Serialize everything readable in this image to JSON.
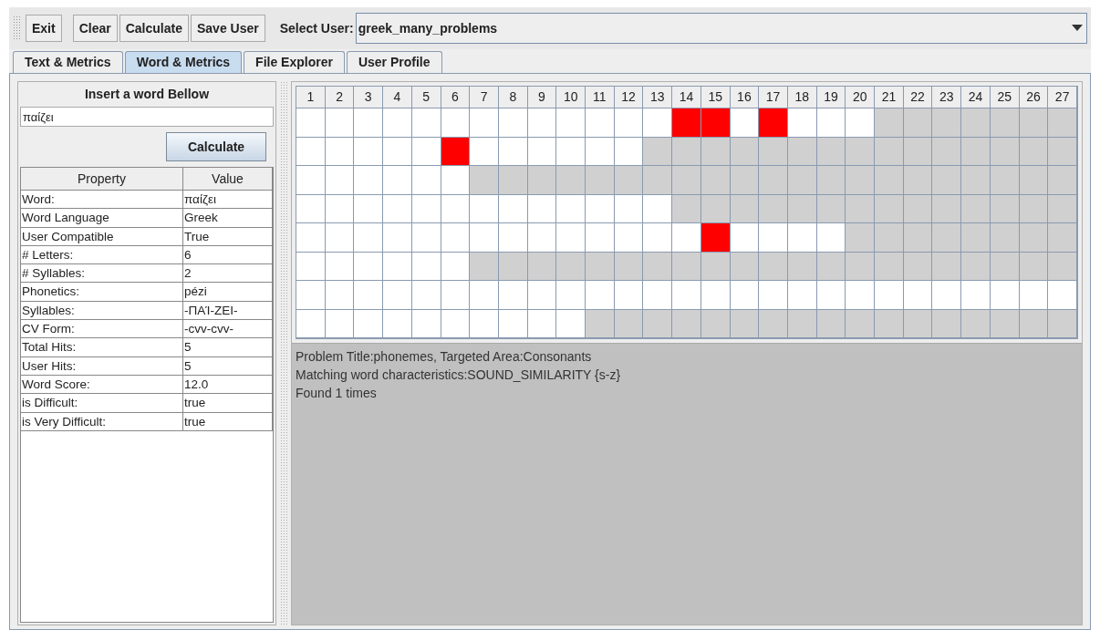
{
  "toolbar": {
    "buttons": [
      "Exit",
      "Clear",
      "Calculate",
      "Save User"
    ],
    "select_label": "Select User:",
    "select_value": "greek_many_problems"
  },
  "tabs": [
    {
      "label": "Text & Metrics",
      "selected": false
    },
    {
      "label": "Word & Metrics",
      "selected": true
    },
    {
      "label": "File Explorer",
      "selected": false
    },
    {
      "label": "User Profile",
      "selected": false
    }
  ],
  "word_panel": {
    "title": "Insert a word Bellow",
    "word": "παίζει",
    "button": "Calculate"
  },
  "properties": {
    "columns": [
      "Property",
      "Value"
    ],
    "rows": [
      [
        "Word:",
        "παίζει"
      ],
      [
        "Word Language",
        "Greek"
      ],
      [
        "User Compatible",
        "True"
      ],
      [
        "# Letters:",
        "6"
      ],
      [
        "# Syllables:",
        "2"
      ],
      [
        "Phonetics:",
        "pézi"
      ],
      [
        "Syllables:",
        "-ΠΑΊ-ΖΕΙ-"
      ],
      [
        "CV Form:",
        "-cvv-cvv-"
      ],
      [
        "Total Hits:",
        "5"
      ],
      [
        "User Hits:",
        "5"
      ],
      [
        "Word Score:",
        "12.0"
      ],
      [
        "is Difficult:",
        "true"
      ],
      [
        "is Very Difficult:",
        "true"
      ]
    ]
  },
  "grid": {
    "columns": [
      "1",
      "2",
      "3",
      "4",
      "5",
      "6",
      "7",
      "8",
      "9",
      "10",
      "11",
      "12",
      "13",
      "14",
      "15",
      "16",
      "17",
      "18",
      "19",
      "20",
      "21",
      "22",
      "23",
      "24",
      "25",
      "26",
      "27"
    ],
    "rows": [
      [
        {
          "kind": "open"
        },
        {
          "kind": "open"
        },
        {
          "kind": "open"
        },
        {
          "kind": "open"
        },
        {
          "kind": "open"
        },
        {
          "kind": "open"
        },
        {
          "kind": "open"
        },
        {
          "kind": "open"
        },
        {
          "kind": "open"
        },
        {
          "kind": "open"
        },
        {
          "kind": "open"
        },
        {
          "kind": "open"
        },
        {
          "kind": "open"
        },
        {
          "kind": "hit"
        },
        {
          "kind": "hit"
        },
        {
          "kind": "open"
        },
        {
          "kind": "hit"
        },
        {
          "kind": "open"
        },
        {
          "kind": "open"
        },
        {
          "kind": "open"
        },
        {
          "kind": "blocked"
        },
        {
          "kind": "blocked"
        },
        {
          "kind": "blocked"
        },
        {
          "kind": "blocked"
        },
        {
          "kind": "blocked"
        },
        {
          "kind": "blocked"
        },
        {
          "kind": "blocked"
        }
      ],
      [
        {
          "kind": "open"
        },
        {
          "kind": "open"
        },
        {
          "kind": "open"
        },
        {
          "kind": "open"
        },
        {
          "kind": "open"
        },
        {
          "kind": "hit"
        },
        {
          "kind": "open"
        },
        {
          "kind": "open"
        },
        {
          "kind": "open"
        },
        {
          "kind": "open"
        },
        {
          "kind": "open"
        },
        {
          "kind": "open"
        },
        {
          "kind": "blocked"
        },
        {
          "kind": "blocked"
        },
        {
          "kind": "blocked"
        },
        {
          "kind": "blocked"
        },
        {
          "kind": "blocked"
        },
        {
          "kind": "blocked"
        },
        {
          "kind": "blocked"
        },
        {
          "kind": "blocked"
        },
        {
          "kind": "blocked"
        },
        {
          "kind": "blocked"
        },
        {
          "kind": "blocked"
        },
        {
          "kind": "blocked"
        },
        {
          "kind": "blocked"
        },
        {
          "kind": "blocked"
        },
        {
          "kind": "blocked"
        }
      ],
      [
        {
          "kind": "open"
        },
        {
          "kind": "open"
        },
        {
          "kind": "open"
        },
        {
          "kind": "open"
        },
        {
          "kind": "open"
        },
        {
          "kind": "open"
        },
        {
          "kind": "blocked"
        },
        {
          "kind": "blocked"
        },
        {
          "kind": "blocked"
        },
        {
          "kind": "blocked"
        },
        {
          "kind": "blocked"
        },
        {
          "kind": "blocked"
        },
        {
          "kind": "blocked"
        },
        {
          "kind": "blocked"
        },
        {
          "kind": "blocked"
        },
        {
          "kind": "blocked"
        },
        {
          "kind": "blocked"
        },
        {
          "kind": "blocked"
        },
        {
          "kind": "blocked"
        },
        {
          "kind": "blocked"
        },
        {
          "kind": "blocked"
        },
        {
          "kind": "blocked"
        },
        {
          "kind": "blocked"
        },
        {
          "kind": "blocked"
        },
        {
          "kind": "blocked"
        },
        {
          "kind": "blocked"
        },
        {
          "kind": "blocked"
        }
      ],
      [
        {
          "kind": "open"
        },
        {
          "kind": "open"
        },
        {
          "kind": "open"
        },
        {
          "kind": "open"
        },
        {
          "kind": "open"
        },
        {
          "kind": "open"
        },
        {
          "kind": "open"
        },
        {
          "kind": "open"
        },
        {
          "kind": "open"
        },
        {
          "kind": "open"
        },
        {
          "kind": "open"
        },
        {
          "kind": "open"
        },
        {
          "kind": "open"
        },
        {
          "kind": "blocked"
        },
        {
          "kind": "blocked"
        },
        {
          "kind": "blocked"
        },
        {
          "kind": "blocked"
        },
        {
          "kind": "blocked"
        },
        {
          "kind": "blocked"
        },
        {
          "kind": "blocked"
        },
        {
          "kind": "blocked"
        },
        {
          "kind": "blocked"
        },
        {
          "kind": "blocked"
        },
        {
          "kind": "blocked"
        },
        {
          "kind": "blocked"
        },
        {
          "kind": "blocked"
        },
        {
          "kind": "blocked"
        }
      ],
      [
        {
          "kind": "open"
        },
        {
          "kind": "open"
        },
        {
          "kind": "open"
        },
        {
          "kind": "open"
        },
        {
          "kind": "open"
        },
        {
          "kind": "open"
        },
        {
          "kind": "open"
        },
        {
          "kind": "open"
        },
        {
          "kind": "open"
        },
        {
          "kind": "open"
        },
        {
          "kind": "open"
        },
        {
          "kind": "open"
        },
        {
          "kind": "open"
        },
        {
          "kind": "open"
        },
        {
          "kind": "hit"
        },
        {
          "kind": "open"
        },
        {
          "kind": "open"
        },
        {
          "kind": "open"
        },
        {
          "kind": "open"
        },
        {
          "kind": "blocked"
        },
        {
          "kind": "blocked"
        },
        {
          "kind": "blocked"
        },
        {
          "kind": "blocked"
        },
        {
          "kind": "blocked"
        },
        {
          "kind": "blocked"
        },
        {
          "kind": "blocked"
        },
        {
          "kind": "blocked"
        }
      ],
      [
        {
          "kind": "open"
        },
        {
          "kind": "open"
        },
        {
          "kind": "open"
        },
        {
          "kind": "open"
        },
        {
          "kind": "open"
        },
        {
          "kind": "open"
        },
        {
          "kind": "blocked"
        },
        {
          "kind": "blocked"
        },
        {
          "kind": "blocked"
        },
        {
          "kind": "blocked"
        },
        {
          "kind": "blocked"
        },
        {
          "kind": "blocked"
        },
        {
          "kind": "blocked"
        },
        {
          "kind": "blocked"
        },
        {
          "kind": "blocked"
        },
        {
          "kind": "blocked"
        },
        {
          "kind": "blocked"
        },
        {
          "kind": "blocked"
        },
        {
          "kind": "blocked"
        },
        {
          "kind": "blocked"
        },
        {
          "kind": "blocked"
        },
        {
          "kind": "blocked"
        },
        {
          "kind": "blocked"
        },
        {
          "kind": "blocked"
        },
        {
          "kind": "blocked"
        },
        {
          "kind": "blocked"
        },
        {
          "kind": "blocked"
        }
      ],
      [
        {
          "kind": "open"
        },
        {
          "kind": "open"
        },
        {
          "kind": "open"
        },
        {
          "kind": "open"
        },
        {
          "kind": "open"
        },
        {
          "kind": "open"
        },
        {
          "kind": "open"
        },
        {
          "kind": "open"
        },
        {
          "kind": "open"
        },
        {
          "kind": "open"
        },
        {
          "kind": "open"
        },
        {
          "kind": "open"
        },
        {
          "kind": "open"
        },
        {
          "kind": "open"
        },
        {
          "kind": "open"
        },
        {
          "kind": "open"
        },
        {
          "kind": "open"
        },
        {
          "kind": "open"
        },
        {
          "kind": "open"
        },
        {
          "kind": "open"
        },
        {
          "kind": "open"
        },
        {
          "kind": "open"
        },
        {
          "kind": "open"
        },
        {
          "kind": "open"
        },
        {
          "kind": "open"
        },
        {
          "kind": "open"
        },
        {
          "kind": "open"
        }
      ],
      [
        {
          "kind": "open"
        },
        {
          "kind": "open"
        },
        {
          "kind": "open"
        },
        {
          "kind": "open"
        },
        {
          "kind": "open"
        },
        {
          "kind": "open"
        },
        {
          "kind": "open"
        },
        {
          "kind": "open"
        },
        {
          "kind": "open"
        },
        {
          "kind": "open"
        },
        {
          "kind": "blocked"
        },
        {
          "kind": "blocked"
        },
        {
          "kind": "blocked"
        },
        {
          "kind": "blocked"
        },
        {
          "kind": "blocked"
        },
        {
          "kind": "blocked"
        },
        {
          "kind": "blocked"
        },
        {
          "kind": "blocked"
        },
        {
          "kind": "blocked"
        },
        {
          "kind": "blocked"
        },
        {
          "kind": "blocked"
        },
        {
          "kind": "blocked"
        },
        {
          "kind": "blocked"
        },
        {
          "kind": "blocked"
        },
        {
          "kind": "blocked"
        },
        {
          "kind": "blocked"
        },
        {
          "kind": "blocked"
        }
      ]
    ]
  },
  "details": [
    "Problem Title:phonemes, Targeted Area:Consonants",
    "Matching word characteristics:SOUND_SIMILARITY {s-z}",
    "Found 1 times"
  ]
}
